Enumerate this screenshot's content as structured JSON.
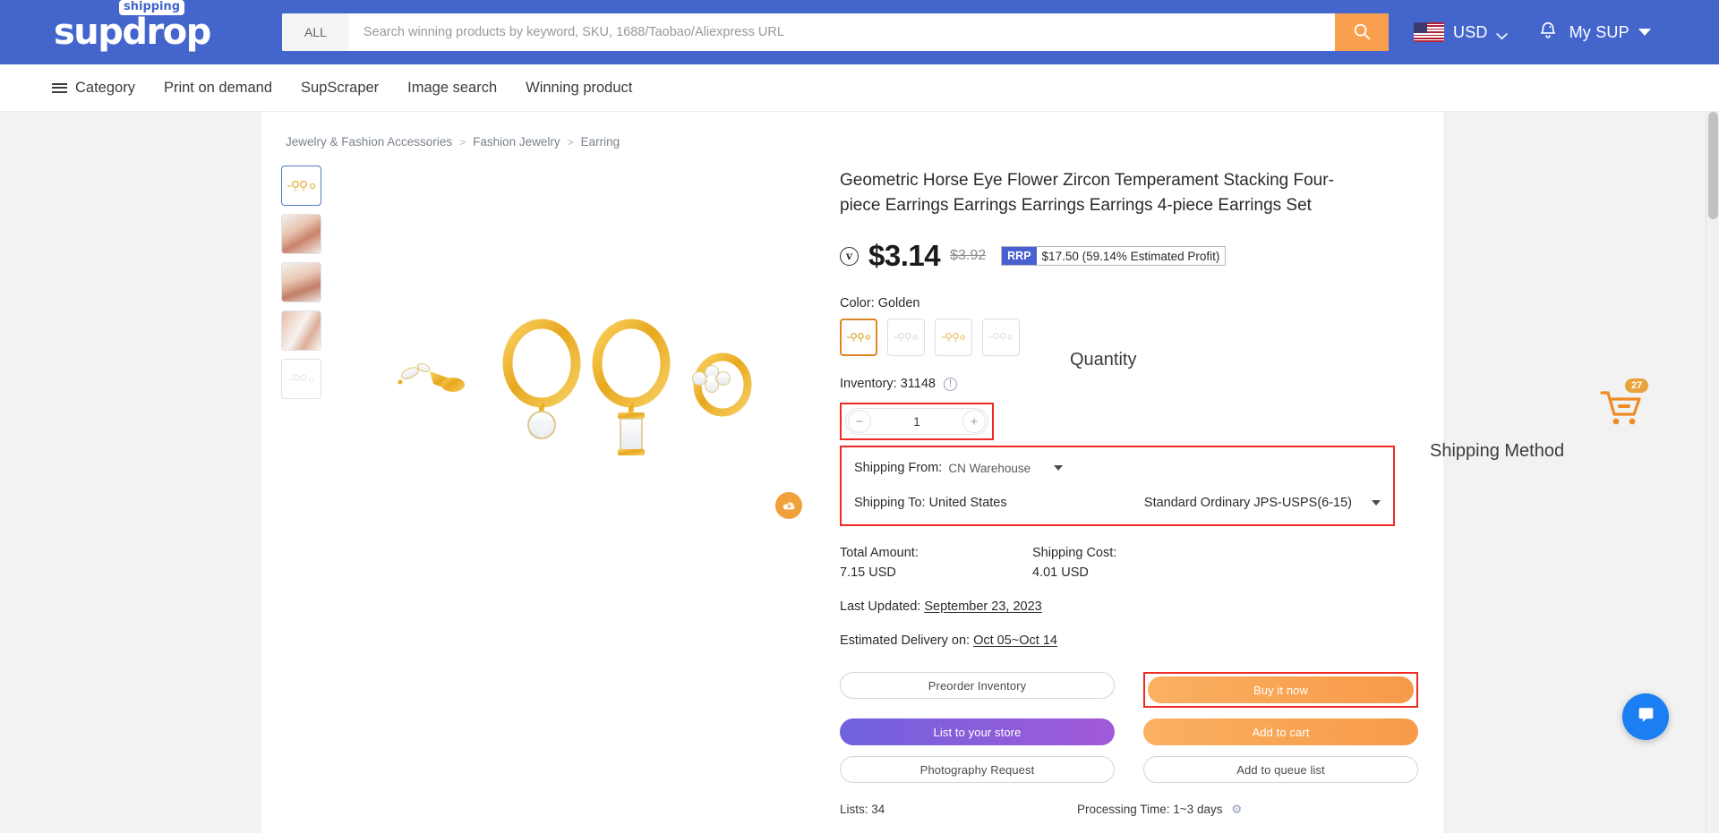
{
  "header": {
    "logo_main": "supdrop",
    "logo_badge": "shipping",
    "search_category": "ALL",
    "search_placeholder": "Search winning products by keyword, SKU, 1688/Taobao/Aliexpress URL",
    "search_value": "",
    "search_icon": "search-icon",
    "flag_icon": "us-flag-icon",
    "currency": "USD",
    "currency_chevron_icon": "chevron-down-icon",
    "bell_icon": "notification-bell-icon",
    "account": "My SUP",
    "account_caret_icon": "caret-down-icon"
  },
  "nav": {
    "menu_icon": "hamburger-menu-icon",
    "items": [
      {
        "label": "Category"
      },
      {
        "label": "Print on demand"
      },
      {
        "label": "SupScraper"
      },
      {
        "label": "Image search"
      },
      {
        "label": "Winning product"
      }
    ]
  },
  "breadcrumb": [
    "Jewelry & Fashion Accessories",
    "Fashion Jewelry",
    "Earring"
  ],
  "breadcrumb_separator": ">",
  "gallery": {
    "download_icon": "cloud-download-icon",
    "thumbs": [
      {
        "name": "thumb-product-flatlay",
        "type": "flatlay",
        "active": true
      },
      {
        "name": "thumb-model-ear-1",
        "type": "model",
        "active": false
      },
      {
        "name": "thumb-model-ear-2",
        "type": "model",
        "active": false
      },
      {
        "name": "thumb-model-ear-3",
        "type": "model-split",
        "active": false
      },
      {
        "name": "thumb-product-white",
        "type": "flatlay-faded",
        "active": false
      }
    ]
  },
  "product": {
    "title": "Geometric Horse Eye Flower Zircon Temperament Stacking Four-piece Earrings Earrings Earrings Earrings 4-piece Earrings Set",
    "verified_mark": "v",
    "price": "$3.14",
    "old_price": "$3.92",
    "rrp_tag": "RRP",
    "rrp_value": "$17.50 (59.14% Estimated Profit)",
    "color_label": "Color: Golden",
    "swatches": [
      {
        "name": "swatch-golden",
        "selected": true
      },
      {
        "name": "swatch-silver",
        "selected": false
      },
      {
        "name": "swatch-gold-alt",
        "selected": false
      },
      {
        "name": "swatch-white",
        "selected": false
      }
    ],
    "inventory_label": "Inventory: 31148",
    "inventory_info_icon": "info-icon"
  },
  "quantity": {
    "minus_label": "−",
    "value": "1",
    "plus_label": "+",
    "annotation": "Quantity"
  },
  "shipping": {
    "from_label": "Shipping From:",
    "from_value": "CN Warehouse",
    "from_caret_icon": "caret-down-icon",
    "to_label": "Shipping To: United States",
    "method_value": "Standard Ordinary JPS-USPS(6-15)",
    "method_caret_icon": "caret-down-icon",
    "annotation": "Shipping Method"
  },
  "totals": {
    "total_label": "Total Amount:",
    "total_value": "7.15 USD",
    "shipping_label": "Shipping Cost:",
    "shipping_value": "4.01 USD"
  },
  "meta": {
    "last_updated_label": "Last Updated:",
    "last_updated_value": "September 23, 2023",
    "delivery_label": "Estimated Delivery on:",
    "delivery_value": "Oct 05~Oct 14"
  },
  "buttons": {
    "preorder": "Preorder Inventory",
    "buy_now": "Buy it now",
    "list_store": "List to your store",
    "add_cart": "Add to cart",
    "photography": "Photography Request",
    "queue": "Add to queue list"
  },
  "footer": {
    "lists": "Lists: 34",
    "processing": "Processing Time: 1~3 days",
    "processing_icon": "gear-icon"
  },
  "float_cart": {
    "icon": "shopping-cart-icon",
    "badge": "27"
  },
  "chat": {
    "icon": "chat-bubble-icon"
  },
  "colors": {
    "brand_blue": "#4466cc",
    "accent_orange": "#f9a04e",
    "highlight_red": "#ee2a23",
    "rrp_blue": "#4a5fd0",
    "purple_gradient_start": "#6f62dd",
    "purple_gradient_end": "#a259d8"
  }
}
